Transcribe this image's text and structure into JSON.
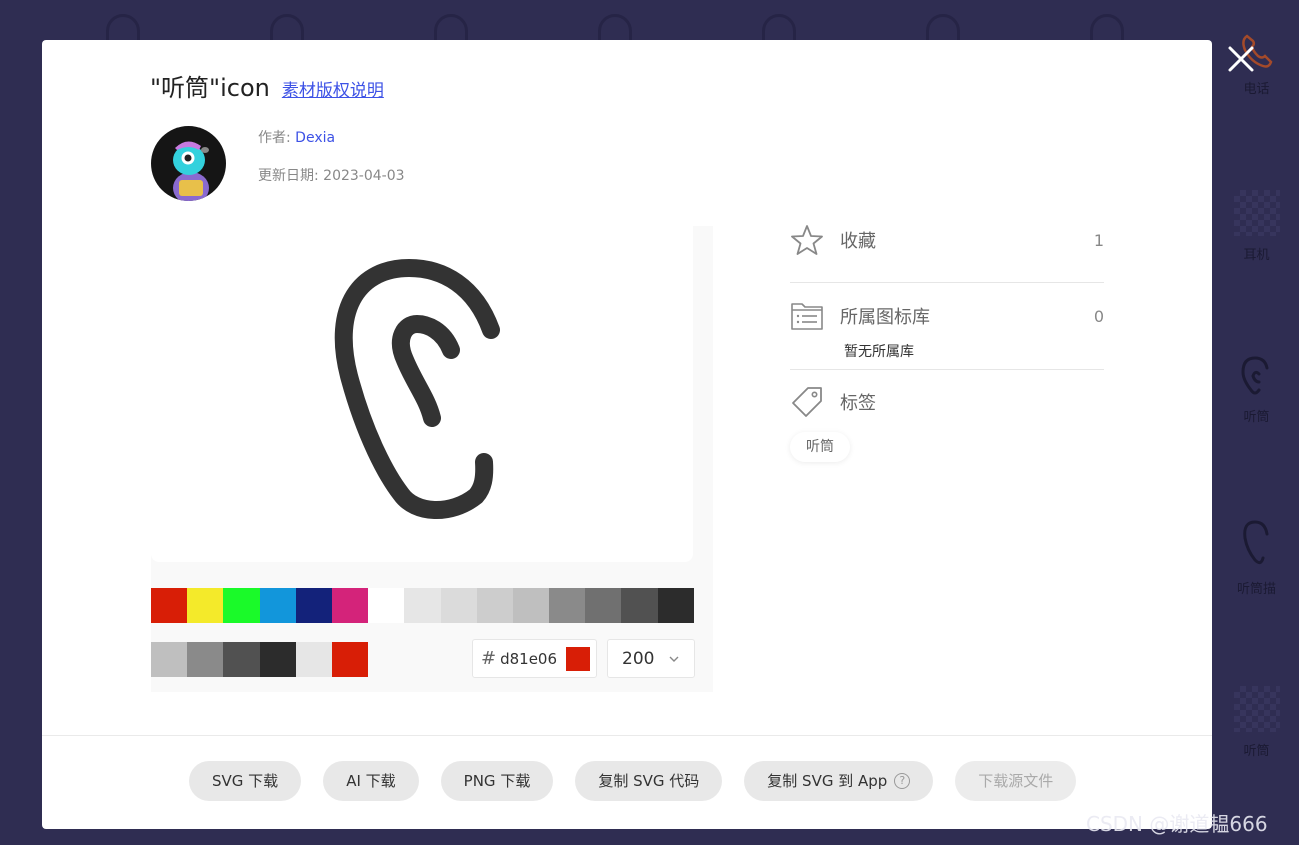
{
  "modal": {
    "title": "\"听筒\"icon",
    "copyright_link": "素材版权说明",
    "author_label": "作者:",
    "author_name": "Dexia",
    "updated_label": "更新日期:",
    "updated_date": "2023-04-03"
  },
  "color_picker": {
    "palette_row1": [
      "#d81e06",
      "#f4ea2a",
      "#1afa29",
      "#1296db",
      "#13227a",
      "#d4237a",
      "#ffffff",
      "#e6e6e6",
      "#dbdbdb",
      "#cdcdcd",
      "#bfbfbf",
      "#8a8a8a",
      "#707070",
      "#515151",
      "#2c2c2c"
    ],
    "palette_row2": [
      "#bfbfbf",
      "#8a8a8a",
      "#515151",
      "#2c2c2c",
      "#e6e6e6",
      "#d81e06"
    ],
    "hex_symbol": "#",
    "hex_value": "d81e06",
    "current_color": "#d81e06",
    "size_value": "200"
  },
  "side": {
    "favorite_label": "收藏",
    "favorite_count": "1",
    "library_label": "所属图标库",
    "library_count": "0",
    "library_empty": "暂无所属库",
    "tags_label": "标签",
    "tags": [
      "听筒"
    ]
  },
  "actions": {
    "svg_download": "SVG 下载",
    "ai_download": "AI 下载",
    "png_download": "PNG 下载",
    "copy_svg_code": "复制 SVG 代码",
    "copy_svg_to_app": "复制 SVG 到 App",
    "help_symbol": "?",
    "download_source": "下载源文件"
  },
  "background": {
    "items": [
      "电话",
      "耳机",
      "听筒",
      "听筒描",
      "听筒"
    ]
  },
  "watermark": "CSDN @谢道韫666",
  "colors": {
    "backdrop": "#2f2d52",
    "link": "#3d52e6",
    "icon_stroke": "#333333"
  }
}
